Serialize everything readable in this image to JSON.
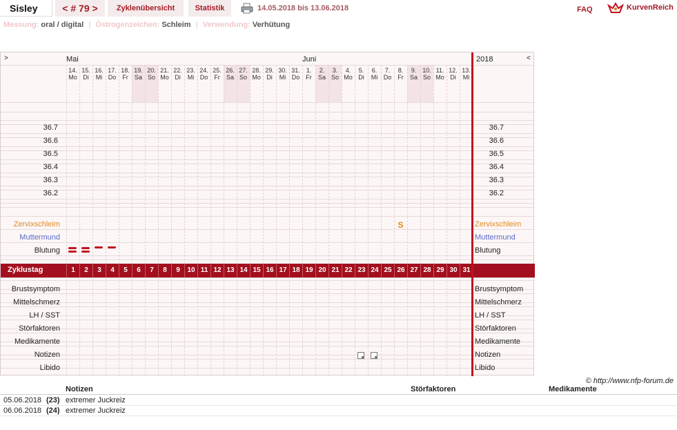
{
  "header": {
    "user_name": "Sisley",
    "cycle_nav": "< # 79 >",
    "tab_overview": "Zyklenübersicht",
    "tab_stats": "Statistik",
    "date_range": "14.05.2018 bis 13.06.2018",
    "faq": "FAQ",
    "logo_text": "KurvenReich"
  },
  "meta": {
    "messung_label": "Messung:",
    "messung_value": "oral / digital",
    "oestrogen_label": "Östrogenzeichen:",
    "oestrogen_value": "Schleim",
    "verwendung_label": "Verwendung:",
    "verwendung_value": "Verhütung"
  },
  "chart": {
    "nav_prev": ">",
    "nav_next": "<",
    "month_may": "Mai",
    "month_june": "Juni",
    "year": "2018",
    "days": [
      {
        "d": "14.",
        "w": "Mo"
      },
      {
        "d": "15.",
        "w": "Di"
      },
      {
        "d": "16.",
        "w": "Mi"
      },
      {
        "d": "17.",
        "w": "Do"
      },
      {
        "d": "18.",
        "w": "Fr"
      },
      {
        "d": "19.",
        "w": "Sa"
      },
      {
        "d": "20.",
        "w": "So"
      },
      {
        "d": "21.",
        "w": "Mo"
      },
      {
        "d": "22.",
        "w": "Di"
      },
      {
        "d": "23.",
        "w": "Mi"
      },
      {
        "d": "24.",
        "w": "Do"
      },
      {
        "d": "25.",
        "w": "Fr"
      },
      {
        "d": "26.",
        "w": "Sa"
      },
      {
        "d": "27.",
        "w": "So"
      },
      {
        "d": "28.",
        "w": "Mo"
      },
      {
        "d": "29.",
        "w": "Di"
      },
      {
        "d": "30.",
        "w": "Mi"
      },
      {
        "d": "31.",
        "w": "Do"
      },
      {
        "d": "1.",
        "w": "Fr"
      },
      {
        "d": "2.",
        "w": "Sa"
      },
      {
        "d": "3.",
        "w": "So"
      },
      {
        "d": "4.",
        "w": "Mo"
      },
      {
        "d": "5.",
        "w": "Di"
      },
      {
        "d": "6.",
        "w": "Mi"
      },
      {
        "d": "7.",
        "w": "Do"
      },
      {
        "d": "8.",
        "w": "Fr"
      },
      {
        "d": "9.",
        "w": "Sa"
      },
      {
        "d": "10.",
        "w": "So"
      },
      {
        "d": "11.",
        "w": "Mo"
      },
      {
        "d": "12.",
        "w": "Di"
      },
      {
        "d": "13.",
        "w": "Mi"
      }
    ],
    "temperatures": [
      "36.7",
      "36.6",
      "36.5",
      "36.4",
      "36.3",
      "36.2"
    ],
    "rows_top": [
      "Zervixschleim",
      "Muttermund",
      "Blutung"
    ],
    "cycleday_label": "Zyklustag",
    "cycledays": [
      "1",
      "2",
      "3",
      "4",
      "5",
      "6",
      "7",
      "8",
      "9",
      "10",
      "11",
      "12",
      "13",
      "14",
      "15",
      "16",
      "17",
      "18",
      "19",
      "20",
      "21",
      "22",
      "23",
      "24",
      "25",
      "26",
      "27",
      "28",
      "29",
      "30",
      "31"
    ],
    "rows_bottom": [
      "Brustsymptom",
      "Mittelschmerz",
      "LH / SST",
      "Störfaktoren",
      "Medikamente",
      "Notizen",
      "Libido"
    ],
    "mucus_marks": [
      {
        "day": 26,
        "symbol": "S"
      }
    ],
    "bleeding": [
      {
        "day": 1,
        "level": "heavy"
      },
      {
        "day": 2,
        "level": "heavy"
      },
      {
        "day": 3,
        "level": "light"
      },
      {
        "day": 4,
        "level": "light"
      }
    ],
    "note_days": [
      23,
      24
    ],
    "colors": {
      "accent": "#a30f1e",
      "mucus": "#e08a1e",
      "cervix": "#5b6bc9",
      "weekend": "#f3e3e5"
    }
  },
  "footer": {
    "copyright": "© http://www.nfp-forum.de",
    "col_notes": "Notizen",
    "col_stoerfaktoren": "Störfaktoren",
    "col_medikamente": "Medikamente",
    "entries": [
      {
        "date": "05.06.2018",
        "day": "(23)",
        "note": "extremer Juckreiz"
      },
      {
        "date": "06.06.2018",
        "day": "(24)",
        "note": "extremer Juckreiz"
      }
    ]
  }
}
